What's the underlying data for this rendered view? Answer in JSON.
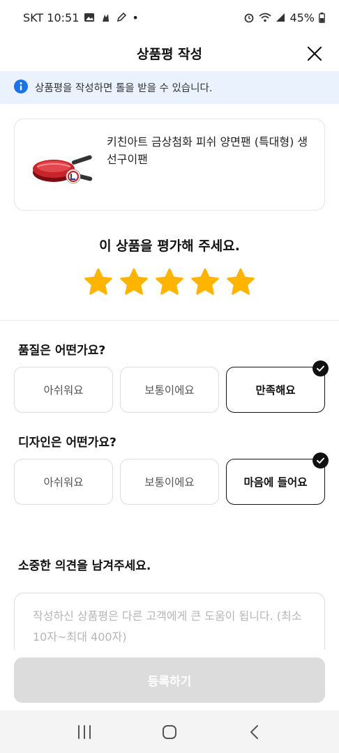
{
  "status_bar": {
    "carrier_time": "SKT 10:51",
    "dot": "•",
    "battery": "45%"
  },
  "header": {
    "title": "상품평 작성",
    "close_icon": "close-icon"
  },
  "notice": {
    "icon": "info-icon",
    "text": "상품평을 작성하면 톨을 받을 수 있습니다.",
    "color": "#1a73e8"
  },
  "product": {
    "name": "키친아트 금상첨화 피쉬 양면팬 (특대형) 생선구이팬",
    "thumbnail": "red-double-sided-fish-pan"
  },
  "rating": {
    "title": "이 상품을 평가해 주세요.",
    "value": 5,
    "max": 5,
    "star_color": "#ffb400"
  },
  "questions": [
    {
      "title": "품질은 어떤가요?",
      "options": [
        "아쉬워요",
        "보통이에요",
        "만족해요"
      ],
      "selected": "만족해요"
    },
    {
      "title": "디자인은 어떤가요?",
      "options": [
        "아쉬워요",
        "보통이에요",
        "마음에 들어요"
      ],
      "selected": "마음에 들어요"
    }
  ],
  "opinion": {
    "title": "소중한 의견을 남겨주세요.",
    "placeholder": "작성하신 상품평은 다른 고객에게 큰 도움이 됩니다. (최소 10자~최대 400자)",
    "value": ""
  },
  "submit": {
    "label": "등록하기"
  },
  "navigation": [
    "recent-apps-icon",
    "home-icon",
    "back-icon"
  ]
}
